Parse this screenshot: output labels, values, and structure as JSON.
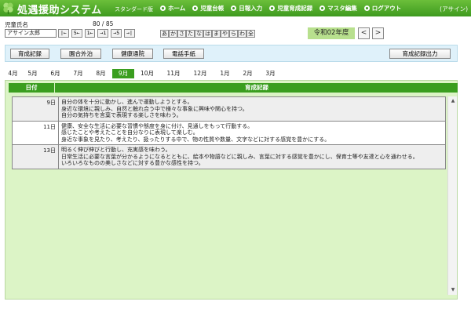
{
  "header": {
    "title": "処遇援助システム",
    "edition": "スタンダード版",
    "user": "(アサイン)",
    "nav": [
      {
        "label": "ホーム"
      },
      {
        "label": "児童台帳"
      },
      {
        "label": "日報入力"
      },
      {
        "label": "児童育成記録"
      },
      {
        "label": "マスタ編集"
      },
      {
        "label": "ログアウト"
      }
    ]
  },
  "child": {
    "label": "児童氏名",
    "count": "80 / 85",
    "selected": "アサイン太郎",
    "pager": [
      "|←",
      "5←",
      "1←",
      "→1",
      "→5",
      "→|"
    ]
  },
  "kana": [
    "あ",
    "か",
    "さ",
    "た",
    "な",
    "は",
    "ま",
    "や",
    "ら",
    "わ",
    "全"
  ],
  "year": {
    "label": "令和02年度",
    "prev": "<",
    "next": ">"
  },
  "toolbar": {
    "growth_record": "育成記録",
    "overnight": "園合外泊",
    "hospital": "健康通院",
    "phone": "電話手紙",
    "export": "育成記録出力"
  },
  "tabs": [
    "4月",
    "5月",
    "6月",
    "7月",
    "8月",
    "9月",
    "10月",
    "11月",
    "12月",
    "1月",
    "2月",
    "3月"
  ],
  "active_tab": "9月",
  "table": {
    "col_date": "日付",
    "col_record": "育成記録",
    "rows": [
      {
        "date": "9日",
        "lines": [
          "自分の体を十分に動かし、進んで運動しようとする。",
          "身近な環境に親しみ、自然と触れ合う中で様々な事象に興味や関心を持つ。",
          "自分の気持ちを言葉で表現する楽しさを味わう。"
        ]
      },
      {
        "date": "11日",
        "lines": [
          "健康、安全な生活に必要な習慣や態度を身に付け、見通しをもって行動する。",
          "感じたことや考えたことを自分なりに表現して楽しむ。",
          "身近な事象を見たり、考えたり、扱ったりする中で、物の性質や数量、文字などに対する感覚を豊かにする。"
        ]
      },
      {
        "date": "13日",
        "lines": [
          "明るく伸び伸びと行動し、充実感を味わう。",
          "日常生活に必要な言葉が分かるようになるとともに、絵本や物語などに親しみ、言葉に対する感覚を豊かにし、保育士等や友達と心を通わせる。",
          "いろいろなものの美しさなどに対する豊かな感性を持つ。"
        ]
      }
    ]
  }
}
